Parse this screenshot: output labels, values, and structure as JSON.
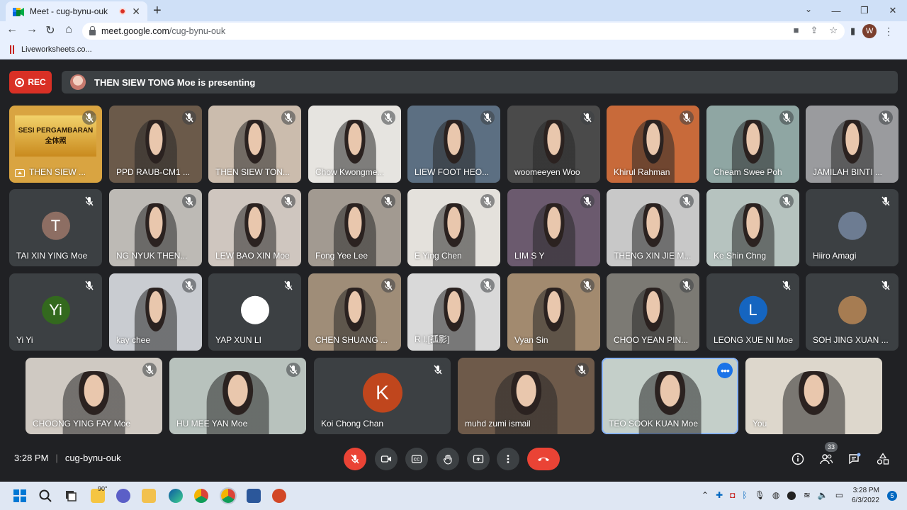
{
  "browser": {
    "tab_title": "Meet - cug-bynu-ouk",
    "url_host": "meet.google.com",
    "url_path": "/cug-bynu-ouk",
    "bookmark": "Liveworksheets.co...",
    "profile_initial": "W"
  },
  "meet": {
    "rec_label": "REC",
    "presenting_text": "THEN SIEW TONG Moe is presenting",
    "time": "3:28 PM",
    "meeting_code": "cug-bynu-ouk",
    "participant_count": "33"
  },
  "participants": [
    {
      "name": "THEN SIEW ...",
      "bg": "#d9a441",
      "presenting": true
    },
    {
      "name": "PPD RAUB-CM1 ...",
      "bg": "#6b5a4a"
    },
    {
      "name": "THEN SIEW TON...",
      "bg": "#cbbcad"
    },
    {
      "name": "Chow Kwongme...",
      "bg": "#e6e4e0"
    },
    {
      "name": "LIEW FOOT HEO...",
      "bg": "#5c6f82"
    },
    {
      "name": "woomeeyen Woo",
      "bg": "#4a4a4a"
    },
    {
      "name": "Khirul Rahman",
      "bg": "#c86a3a"
    },
    {
      "name": "Cheam Swee Poh",
      "bg": "#8fa6a3"
    },
    {
      "name": "JAMILAH BINTI ...",
      "bg": "#9a9b9e"
    },
    {
      "name": "TAI XIN YING Moe",
      "bg": "#3c4043",
      "initial": "T",
      "avatar_color": "#8d6e63"
    },
    {
      "name": "NG NYUK THEN...",
      "bg": "#bdbab5"
    },
    {
      "name": "LEW BAO XIN Moe",
      "bg": "#cfc6bf"
    },
    {
      "name": "Fong Yee Lee",
      "bg": "#a29a91"
    },
    {
      "name": "E Ying Chen",
      "bg": "#e4e1dc"
    },
    {
      "name": "LIM S Y",
      "bg": "#6b5a6e"
    },
    {
      "name": "THENG XIN JIE M...",
      "bg": "#c8c8c8"
    },
    {
      "name": "Ke Shin Chng",
      "bg": "#b6c3bf"
    },
    {
      "name": "Hiiro Amagi",
      "bg": "#3c4043",
      "initial": "",
      "avatar_color": "#6d7c92"
    },
    {
      "name": "Yi Yi",
      "bg": "#3c4043",
      "initial": "Yi",
      "avatar_color": "#33691e"
    },
    {
      "name": "kay chee",
      "bg": "#c9ccd1"
    },
    {
      "name": "YAP XUN LI",
      "bg": "#3c4043",
      "initial": "",
      "avatar_color": "#ffffff"
    },
    {
      "name": "CHEN SHUANG ...",
      "bg": "#9f8d78"
    },
    {
      "name": "R I.[孤影]",
      "bg": "#d9d9d9"
    },
    {
      "name": "Vyan Sin",
      "bg": "#a28a6f"
    },
    {
      "name": "CHOO YEAN PIN...",
      "bg": "#7c7a74"
    },
    {
      "name": "LEONG XUE NI Moe",
      "bg": "#3c4043",
      "initial": "L",
      "avatar_color": "#1565c0"
    },
    {
      "name": "SOH JING XUAN ...",
      "bg": "#3c4043",
      "initial": "",
      "avatar_color": "#a67c52"
    },
    {
      "name": "CHOONG YING FAY Moe",
      "bg": "#cfc9c2"
    },
    {
      "name": "HU MEE YAN Moe",
      "bg": "#b8c2bd"
    },
    {
      "name": "Koi Chong Chan",
      "bg": "#3c4043",
      "initial": "K",
      "avatar_color": "#c0461d",
      "big": true
    },
    {
      "name": "muhd zumi ismail",
      "bg": "#6e5a4a"
    },
    {
      "name": "TEO SOOK KUAN Moe",
      "bg": "#c4cfc9",
      "speaking": true
    },
    {
      "name": "You",
      "bg": "#ddd7cc"
    }
  ],
  "slide_text": {
    "line1": "SESI PERGAMBARAN",
    "line2": "全体照"
  },
  "taskbar": {
    "weather": "90°",
    "clock_time": "3:28 PM",
    "clock_date": "6/3/2022",
    "notifications": "5"
  }
}
